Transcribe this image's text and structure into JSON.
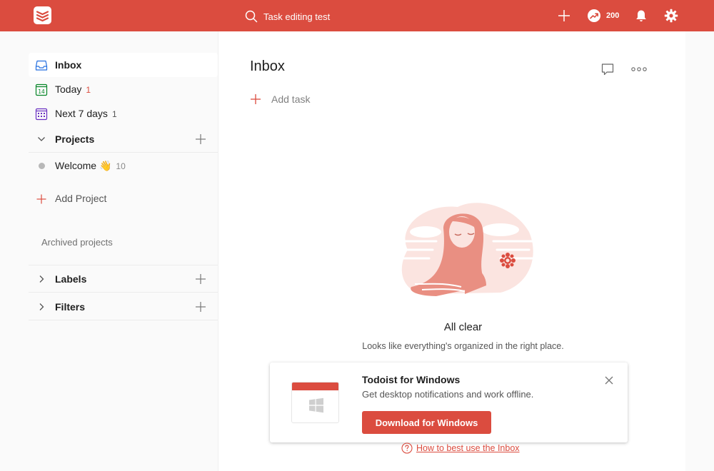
{
  "topbar": {
    "search_placeholder": "Task editing test",
    "karma_count": "200",
    "colors": {
      "bar": "#db4c3f",
      "icon": "#ffffff"
    },
    "icons": [
      "todoist-logo-icon",
      "search-icon",
      "plus-icon",
      "karma-trend-icon",
      "bell-icon",
      "gear-icon"
    ]
  },
  "sidebar": {
    "inbox": {
      "label": "Inbox",
      "icon": "inbox-icon"
    },
    "today": {
      "label": "Today",
      "count": "1",
      "icon": "calendar-today-icon"
    },
    "next7": {
      "label": "Next 7 days",
      "count": "1",
      "icon": "calendar-week-icon"
    },
    "projects": {
      "label": "Projects"
    },
    "welcome": {
      "label": "Welcome",
      "emoji": "👋",
      "count": "10"
    },
    "add_project": {
      "label": "Add Project"
    },
    "archived": {
      "label": "Archived projects"
    },
    "labels": {
      "label": "Labels"
    },
    "filters": {
      "label": "Filters"
    },
    "colors": {
      "count": "#db4c3f",
      "today_icon": "#058527",
      "week_icon": "#692fc2",
      "inbox_icon": "#246fe0"
    }
  },
  "main": {
    "title": "Inbox",
    "add_task": "Add task",
    "empty_title": "All clear",
    "empty_subtitle": "Looks like everything's organized in the right place."
  },
  "promo": {
    "title": "Todoist for Windows",
    "description": "Get desktop notifications and work offline.",
    "button": "Download for Windows"
  },
  "help_link": "How to best use the Inbox"
}
